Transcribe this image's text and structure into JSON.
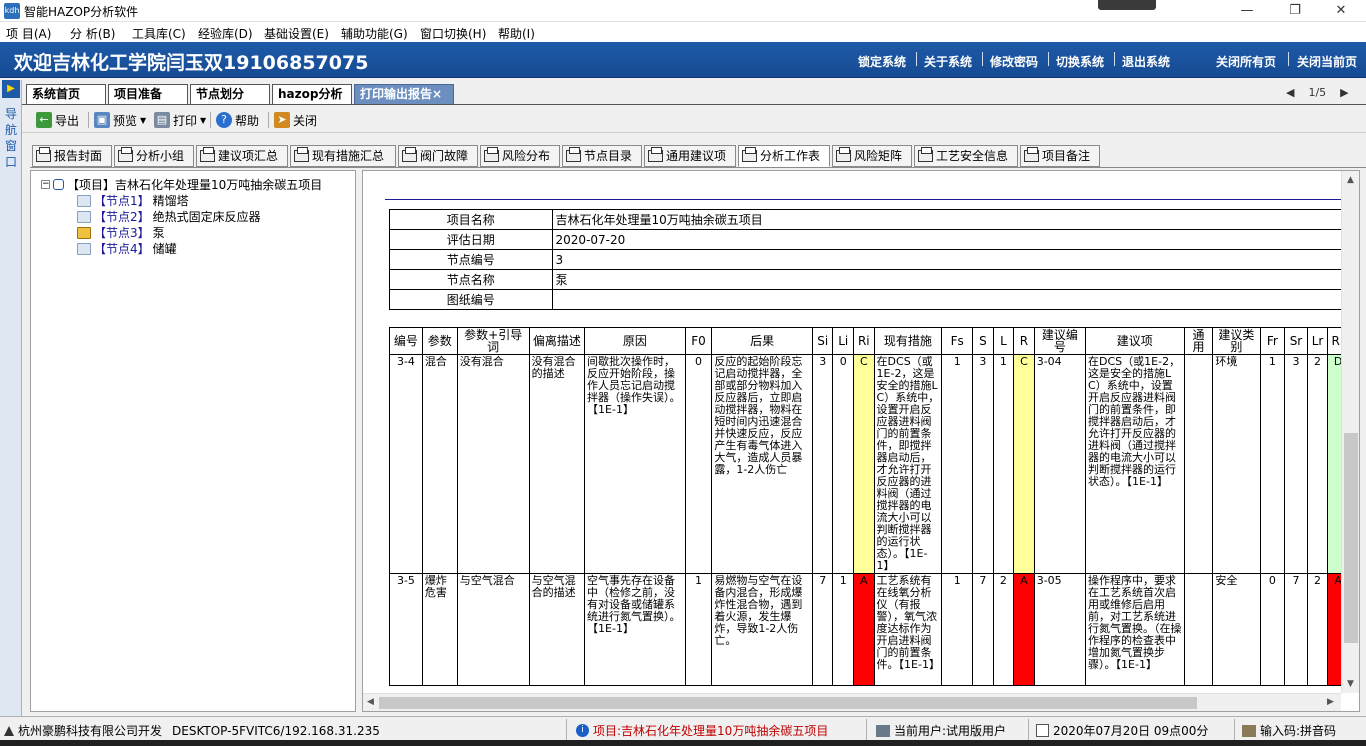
{
  "window": {
    "title": "智能HAZOP分析软件",
    "app_icon": "kdh"
  },
  "menu": [
    "项 目(A)",
    "分 析(B)",
    "工具库(C)",
    "经验库(D)",
    "基础设置(E)",
    "辅助功能(G)",
    "窗口切换(H)",
    "帮助(I)"
  ],
  "banner": {
    "welcome": "欢迎吉林化工学院闫玉双19106857075",
    "links": [
      "锁定系统",
      "关于系统",
      "修改密码",
      "切换系统",
      "退出系统"
    ],
    "right_links": [
      "关闭所有页",
      "关闭当前页"
    ]
  },
  "nav": {
    "label": "导航窗口"
  },
  "main_tabs": [
    "系统首页",
    "项目准备",
    "节点划分",
    "hazop分析",
    "打印输出报告"
  ],
  "pager": "1/5",
  "toolbar": {
    "export": "导出",
    "preview": "预览",
    "print": "打印",
    "help": "帮助",
    "close": "关闭"
  },
  "sub_tabs": [
    "报告封面",
    "分析小组",
    "建议项汇总",
    "现有措施汇总",
    "阀门故障",
    "风险分布",
    "节点目录",
    "通用建议项",
    "分析工作表",
    "风险矩阵",
    "工艺安全信息",
    "项目备注"
  ],
  "tree": {
    "root": "【项目】吉林石化年处理量10万吨抽余碳五项目",
    "nodes": [
      {
        "prefix": "【节点1】",
        "name": "精馏塔"
      },
      {
        "prefix": "【节点2】",
        "name": "绝热式固定床反应器"
      },
      {
        "prefix": "【节点3】",
        "name": "泵"
      },
      {
        "prefix": "【节点4】",
        "name": "储罐"
      }
    ]
  },
  "report": {
    "info": [
      {
        "label": "项目名称",
        "value": "吉林石化年处理量10万吨抽余碳五项目"
      },
      {
        "label": "评估日期",
        "value": "2020-07-20"
      },
      {
        "label": "节点编号",
        "value": "3"
      },
      {
        "label": "节点名称",
        "value": "泵"
      },
      {
        "label": "图纸编号",
        "value": ""
      }
    ],
    "columns": [
      "编号",
      "参数",
      "参数+引导词",
      "偏离描述",
      "原因",
      "F0",
      "后果",
      "Si",
      "Li",
      "Ri",
      "现有措施",
      "Fs",
      "S",
      "L",
      "R",
      "建议编号",
      "建议项",
      "通用",
      "建议类别",
      "Fr",
      "Sr",
      "Lr",
      "Rr"
    ],
    "rows": [
      {
        "id": "3-4",
        "param": "混合",
        "guide": "没有混合",
        "deviation": "没有混合的描述",
        "cause": "间歇批次操作时，反应开始阶段，操作人员忘记启动搅拌器（操作失误）。【1E-1】",
        "f0": "0",
        "consequence": "反应的起始阶段忘记启动搅拌器，全部或部分物料加入反应器后，立即启动搅拌器，物料在短时间内迅速混合并快速反应，反应产生有毒气体进入大气，造成人员暴露，1-2人伤亡",
        "si": "3",
        "li": "0",
        "ri": "C",
        "measure": "在DCS（或1E-2，这是安全的措施LC）系统中，设置开启反应器进料阀门的前置条件，即搅拌器启动后，才允许打开反应器的进料阀（通过搅拌器的电流大小可以判断搅拌器的运行状态）。【1E-1】",
        "fs": "1",
        "s": "3",
        "l": "1",
        "r": "C",
        "sug_id": "3-04",
        "suggestion": "在DCS（或1E-2，这是安全的措施LC）系统中，设置开启反应器进料阀门的前置条件，即搅拌器启动后，才允许打开反应器的进料阀（通过搅拌器的电流大小可以判断搅拌器的运行状态）。【1E-1】",
        "general": "",
        "category": "环境",
        "fr": "1",
        "sr": "3",
        "lr": "2",
        "rr": "D"
      },
      {
        "id": "3-5",
        "param": "爆炸危害",
        "guide": "与空气混合",
        "deviation": "与空气混合的描述",
        "cause": "空气事先存在设备中（检修之前，没有对设备或储罐系统进行氮气置换）。【1E-1】",
        "f0": "1",
        "consequence": "易燃物与空气在设备内混合，形成爆炸性混合物，遇到着火源，发生爆炸，导致1-2人伤亡。",
        "si": "7",
        "li": "1",
        "ri": "A",
        "measure": "工艺系统有在线氧分析仪（有报警），氧气浓度达标作为开启进料阀门的前置条件。【1E-1】",
        "fs": "1",
        "s": "7",
        "l": "2",
        "r": "A",
        "sug_id": "3-05",
        "suggestion": "操作程序中，要求在工艺系统首次启用或维修后启用前，对工艺系统进行氮气置换。（在操作程序的检查表中增加氮气置换步骤）。【1E-1】",
        "general": "",
        "category": "安全",
        "fr": "0",
        "sr": "7",
        "lr": "2",
        "rr": "A"
      }
    ],
    "risk_colors": {
      "C": "#ffff99",
      "A": "#ff0000",
      "D": "#ccffcc"
    }
  },
  "status": {
    "company": "杭州豪鹏科技有限公司开发",
    "host": "DESKTOP-5FVITC6/192.168.31.235",
    "project": "项目:吉林石化年处理量10万吨抽余碳五项目",
    "user": "当前用户:试用版用户",
    "datetime": "2020年07月20日 09点00分",
    "ime": "输入码:拼音码"
  }
}
